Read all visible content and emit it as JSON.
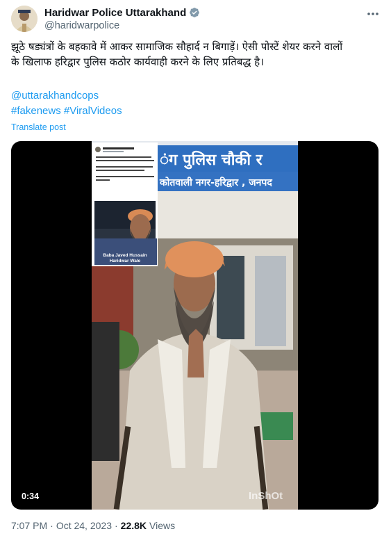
{
  "tweet": {
    "display_name": "Haridwar Police Uttarakhand",
    "handle": "@haridwarpolice",
    "verified_icon": "verified-badge-icon",
    "more_icon": "more-options-icon",
    "text_line1": "झूठे षड्यंत्रों के बहकावे में आकर सामाजिक सौहार्द न बिगाड़ें। ऐसी पोस्टें शेयर करने वालों",
    "text_line2": "के खिलाफ हरिद्वार पुलिस कठोर कार्यवाही करने के लिए प्रतिबद्ध है।",
    "mention": "@uttarakhandcops",
    "hashtag1": "#fakenews",
    "hashtag2": "#ViralVideos",
    "translate_label": "Translate post",
    "time": "7:07 PM",
    "separator": "·",
    "date": "Oct 24, 2023",
    "views_count": "22.8K",
    "views_label": "Views"
  },
  "video": {
    "duration": "0:34",
    "sign_text_top": "ंग पुलिस चौकी र",
    "sign_text_bottom": "कोतवाली नगर-हरिद्वार , जनपद",
    "inset_caption_line1": "Baba Javed Hussain",
    "inset_caption_line2": "Haridwar Wale",
    "watermark": "InShOt"
  },
  "colors": {
    "link": "#1d9bf0",
    "secondary_text": "#536471",
    "primary_text": "#0f1419"
  }
}
